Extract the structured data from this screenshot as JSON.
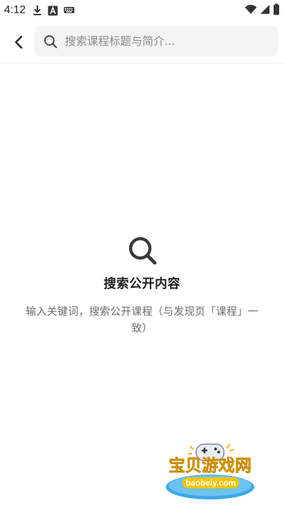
{
  "status_bar": {
    "time": "4:12",
    "icons": [
      "download-icon",
      "font-icon",
      "keyboard-icon",
      "wifi-icon",
      "signal-icon",
      "battery-icon"
    ]
  },
  "header": {
    "back_icon": "chevron-left-icon",
    "search": {
      "icon": "search-icon",
      "value": "",
      "placeholder": "搜索课程标题与简介..."
    }
  },
  "empty_state": {
    "icon": "search-icon",
    "title": "搜索公开内容",
    "description": "输入关键词，搜索公开课程（与发现页「课程」一致）"
  },
  "watermark": {
    "text": "宝贝游戏网",
    "url_text": "baobeiy.com"
  },
  "colors": {
    "accent": "#2d6be0",
    "search_bg": "#f4f4f5",
    "title": "#1d1d1f",
    "desc": "#6b6b70"
  }
}
